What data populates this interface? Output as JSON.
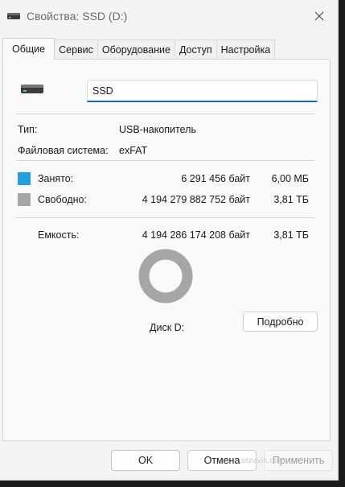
{
  "window": {
    "title": "Свойства: SSD (D:)"
  },
  "tabs": [
    {
      "label": "Общие",
      "active": true
    },
    {
      "label": "Сервис",
      "active": false
    },
    {
      "label": "Оборудование",
      "active": false
    },
    {
      "label": "Доступ",
      "active": false
    },
    {
      "label": "Настройка",
      "active": false
    }
  ],
  "general": {
    "drive_name": "SSD",
    "type_label": "Тип:",
    "type_value": "USB-накопитель",
    "fs_label": "Файловая система:",
    "fs_value": "exFAT",
    "used": {
      "label": "Занято:",
      "bytes": "6 291 456 байт",
      "short": "6,00 МБ",
      "color": "#26a0da"
    },
    "free": {
      "label": "Свободно:",
      "bytes": "4 194 279 882 752 байт",
      "short": "3,81 ТБ",
      "color": "#a6a6a6"
    },
    "capacity": {
      "label": "Емкость:",
      "bytes": "4 194 286 174 208 байт",
      "short": "3,81 ТБ"
    },
    "used_fraction": 1.5e-06,
    "disk_label": "Диск D:",
    "details_button": "Подробно"
  },
  "footer": {
    "ok": "OK",
    "cancel": "Отмена",
    "apply": "Применить"
  },
  "watermark": "otzovik.com",
  "icons": {
    "title": "drive-icon",
    "close": "close-icon",
    "drive": "drive-icon"
  }
}
